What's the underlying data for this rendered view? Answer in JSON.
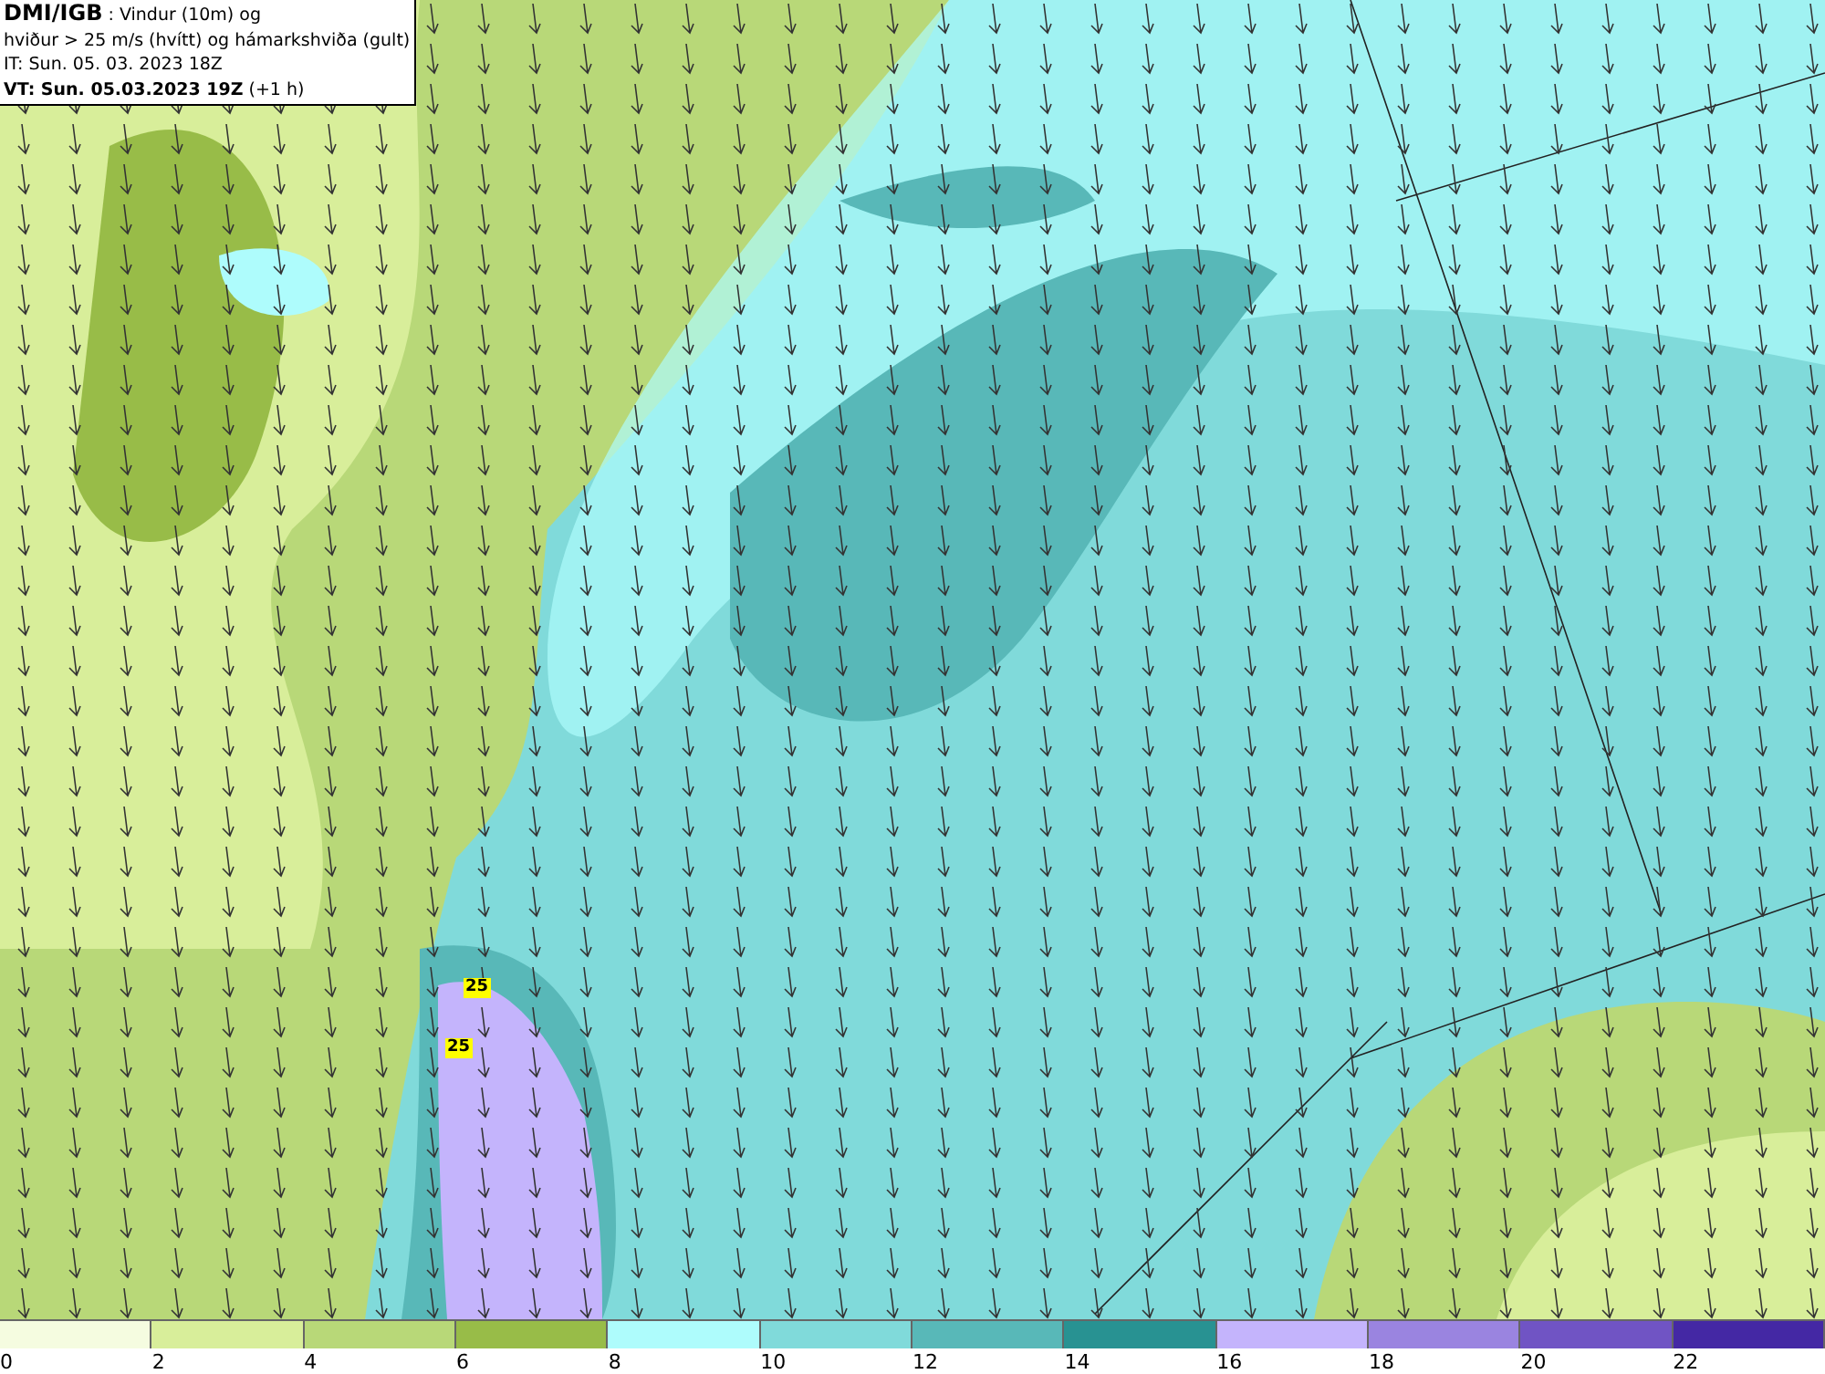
{
  "title_box": {
    "source": "DMI/IGB",
    "description": " : Vindur (10m) og",
    "line2": "hviður > 25 m/s (hvítt) og hámarkshviða (gult)",
    "issue_time": "IT: Sun. 05. 03. 2023 18Z",
    "valid_time": "VT: Sun. 05.03.2023 19Z",
    "offset": " (+1 h)"
  },
  "map": {
    "gust_labels": [
      {
        "text": "25"
      },
      {
        "text": "25"
      }
    ]
  },
  "legend": {
    "ticks": [
      "0",
      "2",
      "4",
      "6",
      "8",
      "10",
      "12",
      "14",
      "16",
      "18",
      "20",
      "22"
    ],
    "bins": [
      {
        "color": "#f5fce0"
      },
      {
        "color": "#d8ee9a"
      },
      {
        "color": "#b8d878"
      },
      {
        "color": "#98bc48"
      },
      {
        "color": "#aefcfc"
      },
      {
        "color": "#80dada"
      },
      {
        "color": "#58b8b8"
      },
      {
        "color": "#289292"
      },
      {
        "color": "#c4b4fc"
      },
      {
        "color": "#9a84e0"
      },
      {
        "color": "#7054c4"
      },
      {
        "color": "#4428a4"
      }
    ]
  }
}
